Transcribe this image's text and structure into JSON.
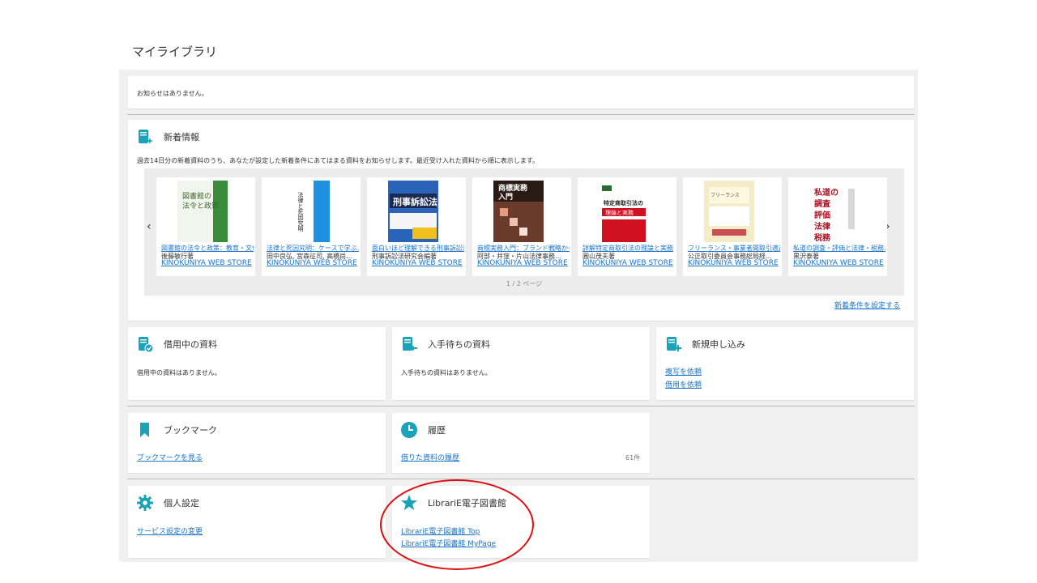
{
  "page_title": "マイライブラリ",
  "notice": {
    "text": "お知らせはありません。"
  },
  "new_arrivals": {
    "title": "新着情報",
    "description": "過去14日分の新着資料のうち、あなたが設定した新着条件にあてはまる資料をお知らせします。最近受け入れた資料から順に表示します。",
    "pager": "1 / 2 ページ",
    "settings_link": "新着条件を設定する",
    "prev_icon": "chevron-left-icon",
    "next_icon": "chevron-right-icon",
    "books": [
      {
        "title": "図書館の法令と政策：教育・文化…",
        "author": "後藤敏行著",
        "source": "KINOKUNIYA WEB STORE",
        "cover_title": "図書館の法令と政策"
      },
      {
        "title": "法律と死因究明：ケースで学ぶ…",
        "author": "田中良弘, 宮森征司, 高橋尚…",
        "source": "KINOKUNIYA WEB STORE",
        "cover_title": "法律と死因究明"
      },
      {
        "title": "面白いほど理解できる刑事訴訟法",
        "author": "刑事訴訟法研究会編著",
        "source": "KINOKUNIYA WEB STORE",
        "cover_title": "刑事訴訟法"
      },
      {
        "title": "商標実務入門：ブランド戦略から…",
        "author": "阿部・井窪・片山法律事務…",
        "source": "KINOKUNIYA WEB STORE",
        "cover_title": "商標実務入門"
      },
      {
        "title": "詳解特定商取引法の理論と実務",
        "author": "圓山茂夫著",
        "source": "KINOKUNIYA WEB STORE",
        "cover_title": "特定商取引法の理論と実務"
      },
      {
        "title": "フリーランス・事業者間取引適正化…",
        "author": "公正取引委員会事務総局経…",
        "source": "KINOKUNIYA WEB STORE",
        "cover_title": "フリーランス"
      },
      {
        "title": "私道の調査・評価と法律・税務…",
        "author": "黒沢泰著",
        "source": "KINOKUNIYA WEB STORE",
        "cover_title": "私道の調査・評価と法律・税務"
      }
    ]
  },
  "borrowing": {
    "title": "借用中の資料",
    "text": "借用中の資料はありません。"
  },
  "waiting": {
    "title": "入手待ちの資料",
    "text": "入手待ちの資料はありません。"
  },
  "new_request": {
    "title": "新規申し込み",
    "links": [
      "複写を依頼",
      "借用を依頼"
    ]
  },
  "bookmark": {
    "title": "ブックマーク",
    "link": "ブックマークを見る"
  },
  "history": {
    "title": "履歴",
    "link": "借りた資料の履歴",
    "count": "61件"
  },
  "personal": {
    "title": "個人設定",
    "link": "サービス設定の変更"
  },
  "librarie": {
    "title": "LibrariE電子図書館",
    "links": [
      "LibrariE電子図書館 Top",
      "LibrariE電子図書館 MyPage"
    ]
  },
  "colors": {
    "accent": "#1aa3b8",
    "link": "#1a73c9",
    "highlight": "#e01010"
  }
}
